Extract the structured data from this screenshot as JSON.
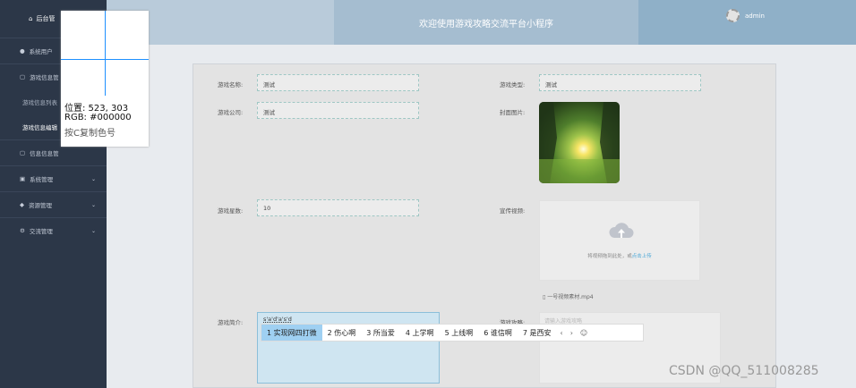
{
  "sidebar": {
    "header": "后台管",
    "items": [
      {
        "label": "系统用户",
        "icon": "user-icon"
      },
      {
        "label": "游戏信息管",
        "icon": "document-icon"
      },
      {
        "label": "游戏信息列表",
        "sub": true
      },
      {
        "label": "游戏信息编辑",
        "sub": true,
        "active": true
      },
      {
        "label": "信息信息管",
        "icon": "document-icon"
      },
      {
        "label": "系统管理",
        "icon": "monitor-icon",
        "arrow": "chevron-down-icon"
      },
      {
        "label": "资源管理",
        "icon": "pin-icon",
        "arrow": "chevron-down-icon"
      },
      {
        "label": "交流管理",
        "icon": "gear-icon",
        "arrow": "chevron-down-icon"
      }
    ]
  },
  "header": {
    "title": "欢迎使用游戏攻略交流平台小程序",
    "user": "admin"
  },
  "form": {
    "name_label": "游戏名称:",
    "name_value": "测试",
    "type_label": "游戏类型:",
    "type_value": "测试",
    "company_label": "游戏公司:",
    "company_value": "测试",
    "cover_label": "封面图片:",
    "score_label": "游戏星数:",
    "score_value": "10",
    "video_label": "宣传视频:",
    "video_upload_text": "将视频拖到此处，或",
    "video_upload_link": "点击上传",
    "video_file": "一号视频素材.mp4",
    "intro_label": "游戏简介:",
    "intro_value": "s'a'd'a's'd",
    "strategy_label": "游戏攻略:",
    "strategy_placeholder": "请输入游戏攻略"
  },
  "ime": {
    "candidates": [
      "1 实现网四打微",
      "2 伤心啊",
      "3 所当爱",
      "4 上学啊",
      "5 上线啊",
      "6 谁信啊",
      "7 是西安"
    ],
    "prev": "‹",
    "next": "›",
    "emoji": "☺"
  },
  "colorpicker": {
    "position": "位置: 523, 303",
    "rgb": "RGB: #000000",
    "hint": "按C复制色号"
  },
  "watermark": "CSDN @QQ_511008285",
  "colors": {
    "sidebar": "#2c3748",
    "header": "#a5bdd0",
    "accent": "#4aa6d6"
  }
}
